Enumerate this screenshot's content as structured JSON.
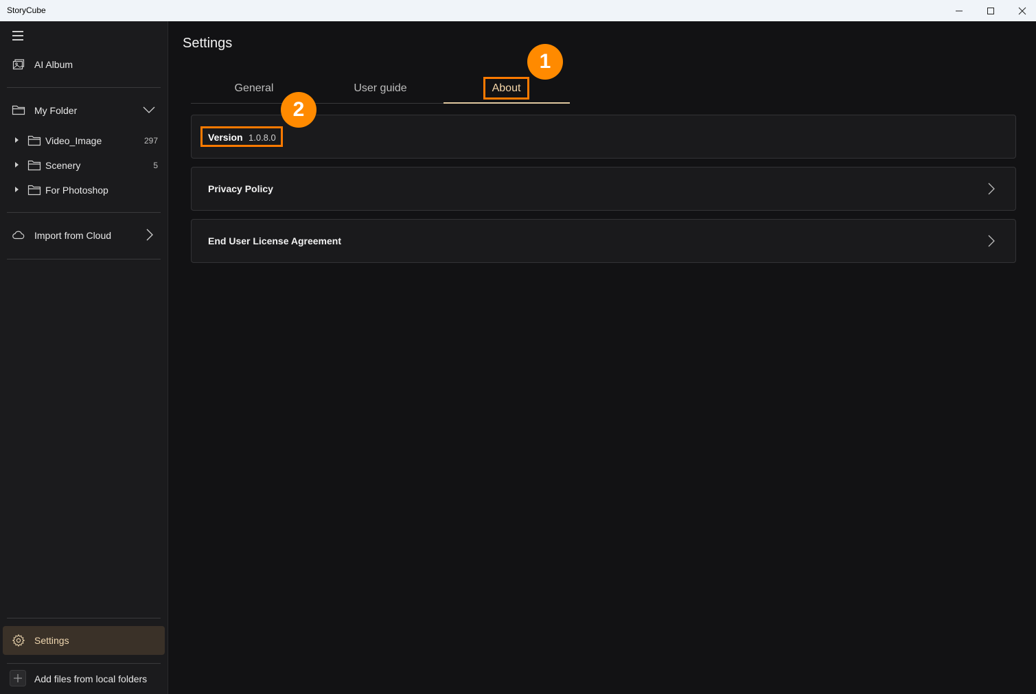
{
  "window": {
    "title": "StoryCube",
    "controls": [
      "minimize-icon",
      "maximize-icon",
      "close-icon"
    ]
  },
  "sidebar": {
    "menu_icon": "hamburger-icon",
    "ai_album": {
      "label": "AI Album",
      "icon": "album-icon"
    },
    "my_folder": {
      "label": "My Folder",
      "icon": "folder-icon",
      "expand_icon": "chevron-down-icon"
    },
    "folders": [
      {
        "label": "Video_Image",
        "count": "297"
      },
      {
        "label": "Scenery",
        "count": "5"
      },
      {
        "label": "For Photoshop",
        "count": ""
      }
    ],
    "import_cloud": {
      "label": "Import from Cloud",
      "icon": "cloud-icon"
    },
    "settings": {
      "label": "Settings",
      "icon": "gear-icon"
    },
    "add_files": {
      "label": "Add files from local folders",
      "icon": "plus-icon"
    }
  },
  "main": {
    "title": "Settings",
    "tabs": [
      {
        "label": "General"
      },
      {
        "label": "User guide"
      },
      {
        "label": "About",
        "active": true
      }
    ],
    "version": {
      "label": "Version",
      "value": "1.0.8.0"
    },
    "privacy": {
      "label": "Privacy Policy"
    },
    "eula": {
      "label": "End User License Agreement"
    },
    "badges": [
      "1",
      "2"
    ]
  },
  "colors": {
    "accent": "#ff8a00",
    "background": "#121214",
    "sidebar": "#1b1b1d",
    "active_tab_text": "#f5d6a8"
  }
}
